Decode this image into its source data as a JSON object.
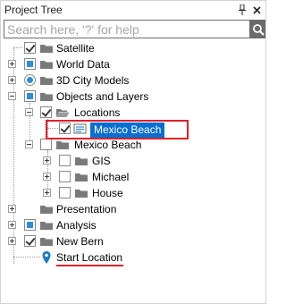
{
  "panel": {
    "title": "Project Tree",
    "pin_icon": "pin-icon",
    "close_icon": "close-icon"
  },
  "search": {
    "placeholder": "Search here, '?' for help",
    "value": "",
    "button_icon": "search-icon"
  },
  "tree": {
    "items": [
      {
        "label": "Satellite",
        "control": "checkbox-checked",
        "icon": "folder-icon",
        "expander": "none"
      },
      {
        "label": "World Data",
        "control": "checkbox-partial",
        "icon": "folder-icon",
        "expander": "plus"
      },
      {
        "label": "3D City Models",
        "control": "radio-on",
        "icon": "folder-icon",
        "expander": "plus"
      },
      {
        "label": "Objects and Layers",
        "control": "checkbox-partial",
        "icon": "folder-icon",
        "expander": "minus"
      },
      {
        "label": "Locations",
        "control": "checkbox-checked",
        "icon": "folder-open-icon",
        "expander": "minus"
      },
      {
        "label": "Mexico Beach",
        "control": "checkbox-checked",
        "icon": "location-layer-icon",
        "expander": "none",
        "selected": true
      },
      {
        "label": "Mexico Beach",
        "control": "checkbox-empty",
        "icon": "folder-icon",
        "expander": "minus"
      },
      {
        "label": "GIS",
        "control": "checkbox-empty",
        "icon": "folder-icon",
        "expander": "plus"
      },
      {
        "label": "Michael",
        "control": "checkbox-empty",
        "icon": "folder-icon",
        "expander": "plus"
      },
      {
        "label": "House",
        "control": "checkbox-empty",
        "icon": "folder-icon",
        "expander": "plus"
      },
      {
        "label": "Presentation",
        "control": "none",
        "icon": "folder-icon",
        "expander": "plus"
      },
      {
        "label": "Analysis",
        "control": "checkbox-partial",
        "icon": "folder-icon",
        "expander": "plus"
      },
      {
        "label": "New Bern",
        "control": "checkbox-checked",
        "icon": "folder-icon",
        "expander": "plus"
      },
      {
        "label": "Start Location",
        "control": "none",
        "icon": "map-pin-icon",
        "expander": "none"
      }
    ]
  },
  "colors": {
    "selection_bg": "#0a6ed1",
    "annotation_red": "#e0202a",
    "partial_blue": "#2f8ed6",
    "folder_gray": "#7a7a7a",
    "pin_blue": "#1f78c8"
  }
}
